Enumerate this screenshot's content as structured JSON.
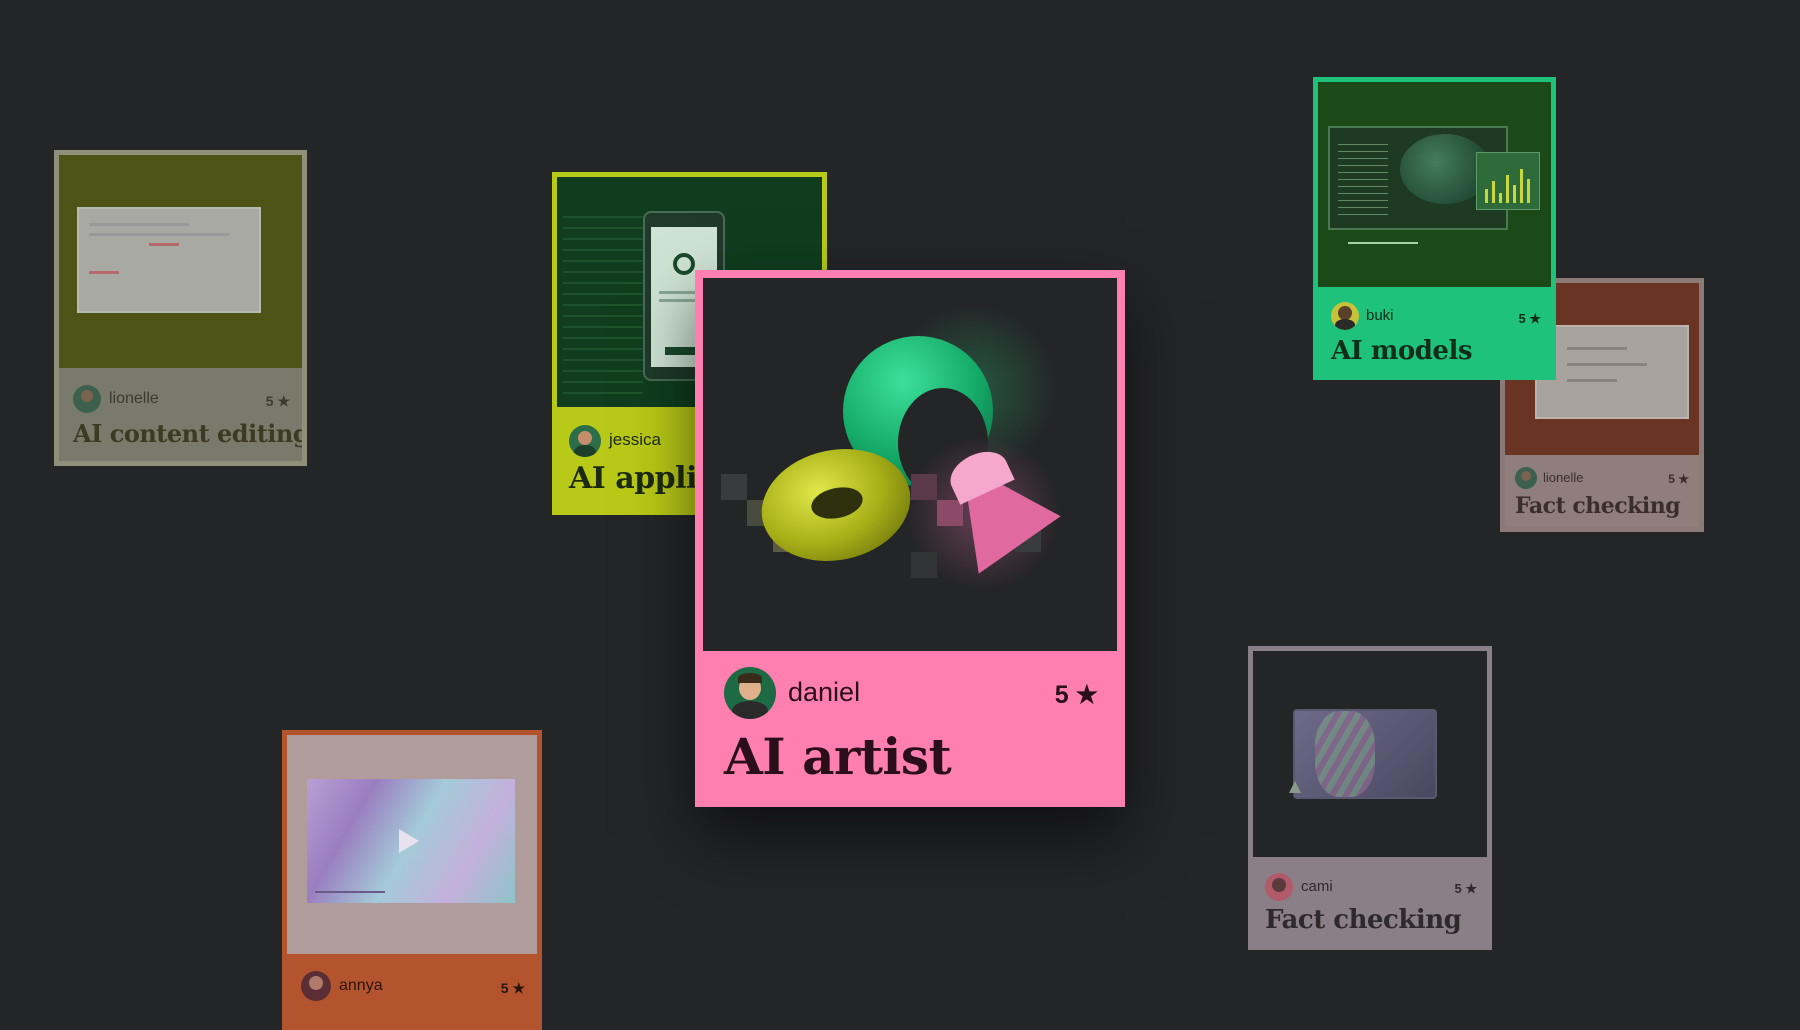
{
  "cards": {
    "content_editing": {
      "user": "lionelle",
      "rating": "5 ★",
      "title": "AI content editing"
    },
    "applications": {
      "user": "jessica",
      "title": "AI applic"
    },
    "artist": {
      "user": "daniel",
      "rating": "5 ★",
      "title": "AI artist"
    },
    "models": {
      "user": "buki",
      "rating": "5 ★",
      "title": "AI models"
    },
    "fact_checking_right": {
      "user": "lionelle",
      "rating": "5 ★",
      "title": "Fact checking"
    },
    "fact_checking_bottom": {
      "user": "cami",
      "rating": "5 ★",
      "title": "Fact checking"
    },
    "video": {
      "user": "annya",
      "rating": "5 ★"
    }
  },
  "colors": {
    "background": "#242527",
    "artist_pink": "#ff7fb0",
    "models_green": "#1ec27a",
    "applications_lime": "#b8c917",
    "video_orange": "#b4542f"
  },
  "icons": {
    "play": "play-icon",
    "star": "star-icon"
  }
}
